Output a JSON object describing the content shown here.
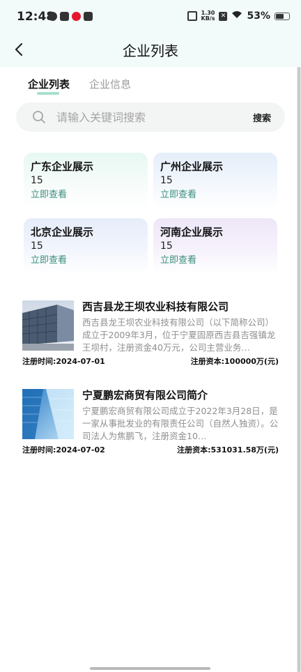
{
  "status_bar": {
    "time": "12:48",
    "net_speed_value": "1.30",
    "net_speed_unit": "KB/s",
    "battery_percent": "53%",
    "battery_level": 0.53
  },
  "header": {
    "title": "企业列表",
    "back_icon": "chevron-left-icon"
  },
  "tabs": [
    {
      "label": "企业列表",
      "active": true
    },
    {
      "label": "企业信息",
      "active": false
    }
  ],
  "search": {
    "placeholder": "请输入关键词搜索",
    "button_label": "搜索",
    "icon": "search-icon"
  },
  "regions": [
    {
      "title": "广东企业展示",
      "count": "15",
      "link": "立即查看"
    },
    {
      "title": "广州企业展示",
      "count": "15",
      "link": "立即查看"
    },
    {
      "title": "北京企业展示",
      "count": "15",
      "link": "立即查看"
    },
    {
      "title": "河南企业展示",
      "count": "15",
      "link": "立即查看"
    }
  ],
  "companies": [
    {
      "title": "西吉县龙王坝农业科技有限公司",
      "description": "西吉县龙王坝农业科技有限公司（以下简称公司）成立于2009年3月，位于宁夏固原西吉县吉强镇龙王坝村，注册资金40万元，公司主营业务…",
      "reg_time": "注册时间:2024-07-01",
      "reg_capital": "注册资本:100000万(元)"
    },
    {
      "title": "宁夏鹏宏商贸有限公司简介",
      "description": "宁夏鹏宏商贸有限公司成立于2022年3月28日，是一家从事批发业的有限责任公司（自然人独资）。公司法人为焦鹏飞，注册资金10…",
      "reg_time": "注册时间:2024-07-02",
      "reg_capital": "注册资本:531031.58万(元)"
    }
  ]
}
